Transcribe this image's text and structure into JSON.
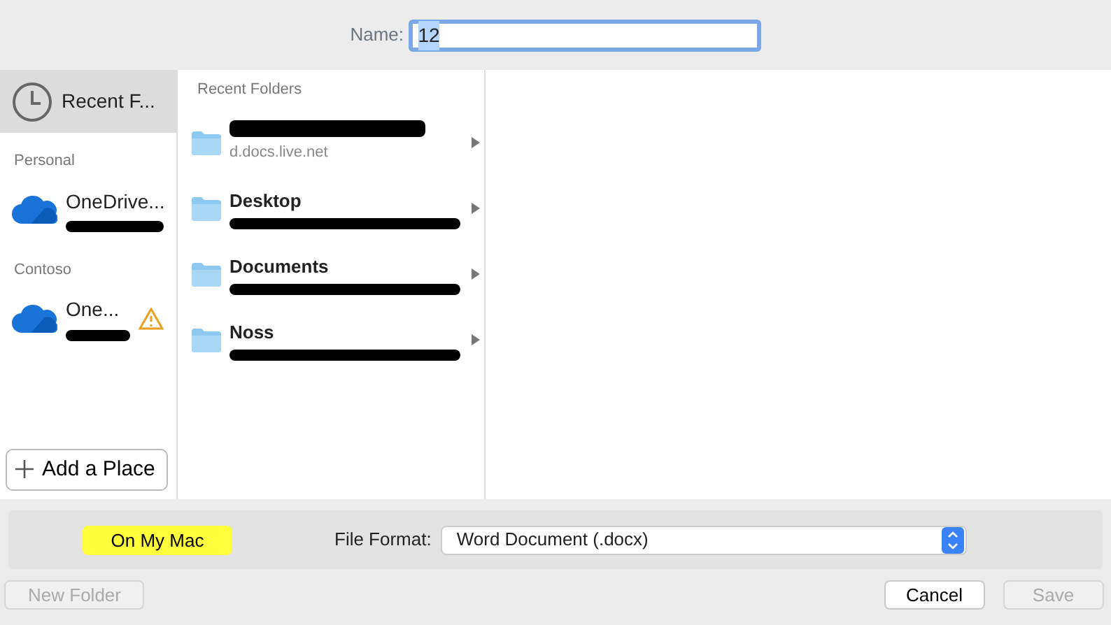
{
  "name_field": {
    "label": "Name:",
    "value": "12",
    "text_selected": true
  },
  "sidebar": {
    "items": [
      {
        "kind": "recent",
        "label": "Recent F...",
        "selected": true
      },
      {
        "kind": "heading",
        "label": "Personal"
      },
      {
        "kind": "cloud",
        "label": "OneDrive...",
        "redacted": true,
        "warning": false,
        "selected": false
      },
      {
        "kind": "heading",
        "label": "Contoso"
      },
      {
        "kind": "cloud",
        "label": "One...",
        "redacted": true,
        "warning": true,
        "selected": false
      }
    ],
    "add_button": {
      "label": "Add a Place"
    }
  },
  "recent_folders": {
    "heading": "Recent Folders",
    "items": [
      {
        "subtitle": "d.docs.live.net"
      },
      {
        "name": "Desktop"
      },
      {
        "name": "Documents"
      },
      {
        "name": "Noss"
      }
    ]
  },
  "location_button": {
    "label": "On My Mac",
    "highlighted": true
  },
  "file_format": {
    "label": "File Format:",
    "value": "Word Document (.docx)"
  },
  "buttons": [
    {
      "kind": "new_folder",
      "label": "New Folder",
      "disabled": true
    },
    {
      "kind": "cancel",
      "label": "Cancel",
      "disabled": false
    },
    {
      "kind": "save",
      "label": "Save",
      "disabled": true
    }
  ]
}
